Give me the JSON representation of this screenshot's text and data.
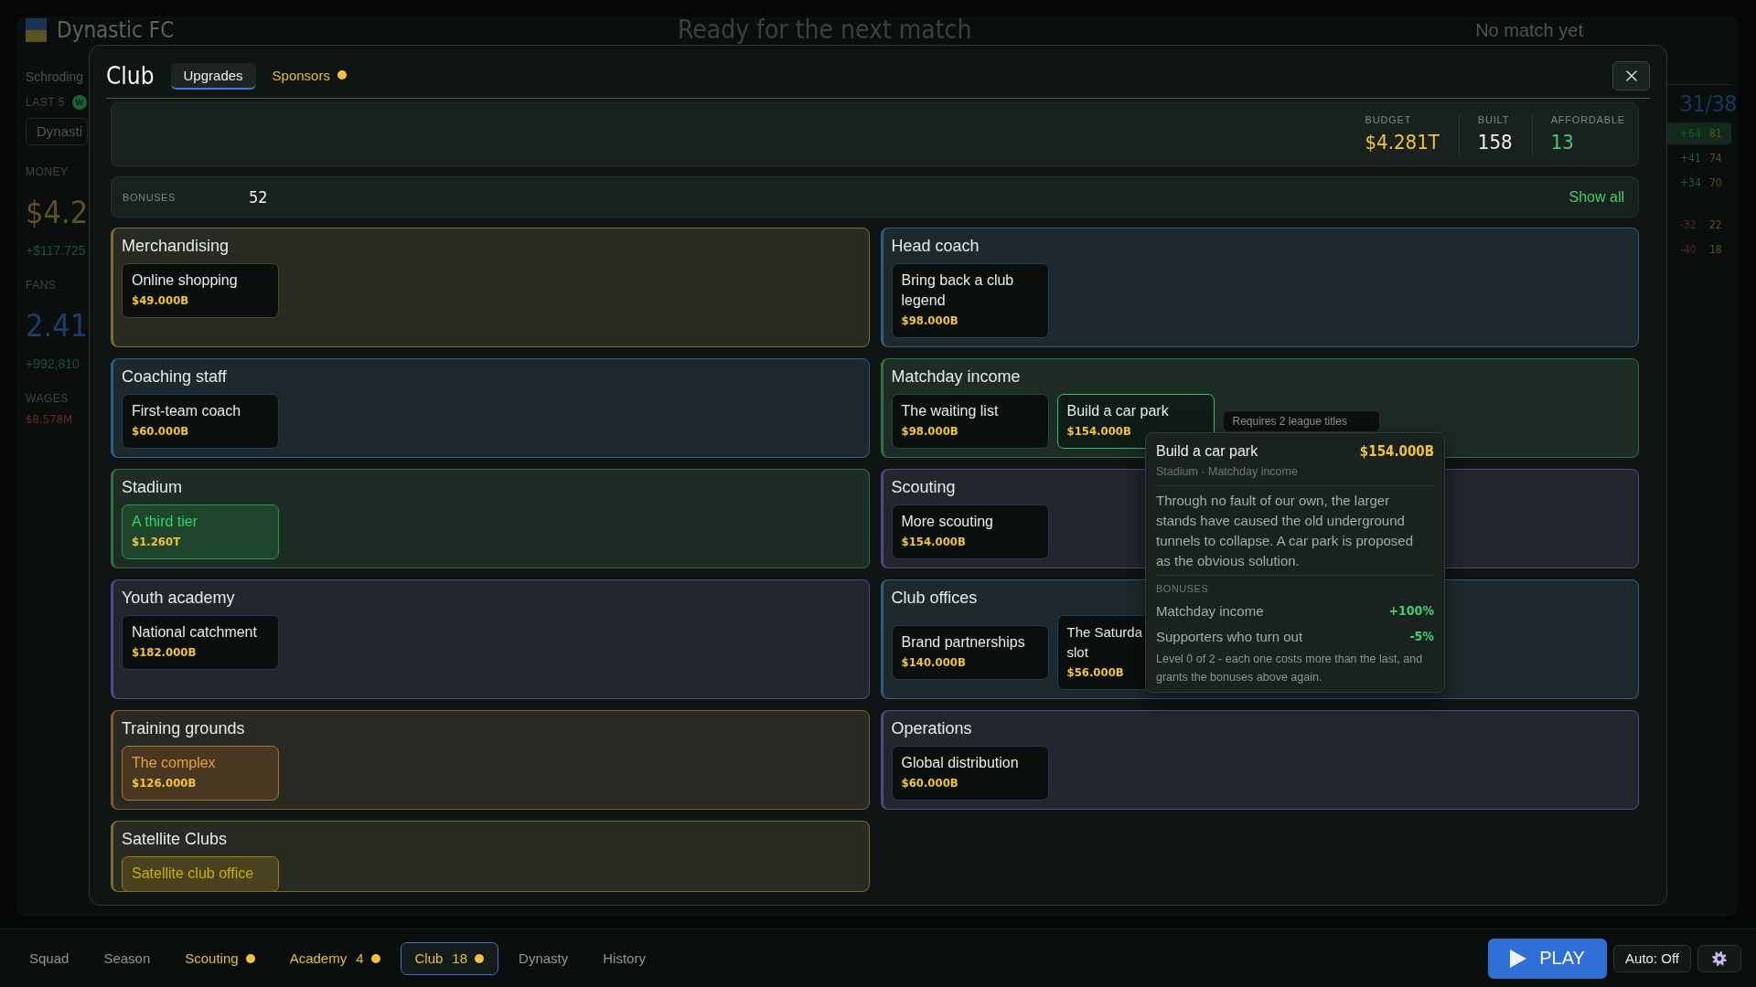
{
  "background": {
    "club": "Dynastic FC",
    "manager": "Schroding",
    "form": {
      "label": "LAST 5",
      "results": [
        {
          "letter": "W",
          "color": "#1b5e37"
        }
      ]
    },
    "team_select": "Dynasti",
    "stats": [
      {
        "kind": "big",
        "label": "MONEY",
        "value": "$4.2",
        "change": "+$117.725",
        "color": "#5e5222"
      },
      {
        "kind": "big",
        "label": "FANS",
        "value": "2.41",
        "change": "+992,810",
        "color": "#1f3d6b"
      },
      {
        "kind": "small",
        "label": "WAGES",
        "value": "$8.578M",
        "color": "#6a2824"
      }
    ],
    "headline": "Ready for the next match",
    "next_match": "No match yet",
    "league": {
      "progress": "31/38",
      "groups": [
        {
          "rows": [
            {
              "difference": "+64",
              "points": "81",
              "kind": "up",
              "highlighted": true
            },
            {
              "difference": "+41",
              "points": "74",
              "kind": "up",
              "highlighted": false
            },
            {
              "difference": "+34",
              "points": "70",
              "kind": "up",
              "highlighted": false
            }
          ]
        },
        {
          "rows": [
            {
              "difference": "-32",
              "points": "22",
              "kind": "down",
              "highlighted": false
            },
            {
              "difference": "-40",
              "points": "18",
              "kind": "down",
              "highlighted": false
            }
          ]
        }
      ]
    }
  },
  "modal": {
    "title": "Club",
    "tabs": [
      {
        "label": "Upgrades",
        "selected": true,
        "alert": false
      },
      {
        "label": "Sponsors",
        "selected": false,
        "alert": true
      }
    ],
    "summary": [
      {
        "label": "BUDGET",
        "value": "$4.281T",
        "kind": "money"
      },
      {
        "label": "BUILT",
        "value": "158",
        "kind": "plain"
      },
      {
        "label": "AFFORDABLE",
        "value": "13",
        "kind": "good"
      }
    ],
    "bonuses": {
      "label": "BONUSES",
      "count": "52",
      "action": "Show all"
    },
    "categories": [
      {
        "title": "Merchandising",
        "color": "#7d6c2c",
        "items": [
          {
            "kind": "upgrade",
            "name": "Online shopping",
            "price": "$49.000B",
            "owned": false,
            "hovered": false,
            "clipped": false
          }
        ]
      },
      {
        "title": "Head coach",
        "color": "#2b5f86",
        "items": [
          {
            "kind": "upgrade",
            "name": "Bring back a club legend",
            "price": "$98.000B",
            "owned": false,
            "hovered": false,
            "clipped": false
          }
        ]
      },
      {
        "title": "Coaching staff",
        "color": "#2b5f86",
        "items": [
          {
            "kind": "upgrade",
            "name": "First-team coach",
            "price": "$60.000B",
            "owned": false,
            "hovered": false,
            "clipped": false
          }
        ]
      },
      {
        "title": "Matchday income",
        "color": "#2d7444",
        "items": [
          {
            "kind": "upgrade",
            "name": "The waiting list",
            "price": "$98.000B",
            "owned": false,
            "hovered": false,
            "clipped": false
          },
          {
            "kind": "upgrade",
            "name": "Build a car park",
            "price": "$154.000B",
            "owned": false,
            "hovered": true,
            "clipped": false
          },
          {
            "kind": "locked",
            "label": "Requires 2 league titles"
          }
        ]
      },
      {
        "title": "Stadium",
        "color": "#2d7444",
        "items": [
          {
            "kind": "upgrade",
            "name": "A third tier",
            "price": "$1.260T",
            "owned": true,
            "hovered": false,
            "clipped": false
          }
        ]
      },
      {
        "title": "Scouting",
        "color": "#54478a",
        "items": [
          {
            "kind": "upgrade",
            "name": "More scouting",
            "price": "$154.000B",
            "owned": false,
            "hovered": false,
            "clipped": false
          }
        ]
      },
      {
        "title": "Youth academy",
        "color": "#54478a",
        "items": [
          {
            "kind": "upgrade",
            "name": "National catchment",
            "price": "$182.000B",
            "owned": false,
            "hovered": false,
            "clipped": false
          }
        ]
      },
      {
        "title": "Club offices",
        "color": "#2b5f86",
        "items": [
          {
            "kind": "upgrade",
            "name": "Brand partnerships",
            "price": "$140.000B",
            "owned": false,
            "hovered": false,
            "clipped": false
          },
          {
            "kind": "upgrade",
            "name": "The Saturda slot",
            "price": "$56.000B",
            "owned": false,
            "hovered": false,
            "clipped": true
          }
        ]
      },
      {
        "title": "Training grounds",
        "color": "#7f5a2e",
        "items": [
          {
            "kind": "upgrade",
            "name": "The complex",
            "price": "$126.000B",
            "owned": true,
            "hovered": false,
            "clipped": false
          }
        ]
      },
      {
        "title": "Operations",
        "color": "#54478a",
        "items": [
          {
            "kind": "upgrade",
            "name": "Global distribution",
            "price": "$60.000B",
            "owned": false,
            "hovered": false,
            "clipped": false
          }
        ]
      },
      {
        "title": "Satellite Clubs",
        "color": "#7d6c2c",
        "items": [
          {
            "kind": "upgrade",
            "name": "Satellite club office",
            "owned": true,
            "hovered": false,
            "clipped": false
          }
        ]
      }
    ],
    "tooltip": {
      "title": "Build a car park",
      "price": "$154.000B",
      "path": "Stadium · Matchday income",
      "description": "Through no fault of our own, the larger stands have caused the old underground tunnels to collapse. A car park is proposed as the obvious solution.",
      "bonuses_label": "BONUSES",
      "bonuses": [
        {
          "name": "Matchday income",
          "value": "+100%"
        },
        {
          "name": "Supporters who turn out",
          "value": "-5%"
        }
      ],
      "note": "Level 0 of 2 - each one costs more than the last, and grants the bonuses above again."
    }
  },
  "nav": {
    "tabs": [
      {
        "label": "Squad",
        "selected": false,
        "alert": false
      },
      {
        "label": "Season",
        "selected": false,
        "alert": false
      },
      {
        "label": "Scouting",
        "selected": false,
        "alert": true
      },
      {
        "label": "Academy",
        "count": "4",
        "selected": false,
        "alert": true
      },
      {
        "label": "Club",
        "count": "18",
        "selected": true,
        "alert": true
      },
      {
        "label": "Dynasty",
        "selected": false,
        "alert": false
      },
      {
        "label": "History",
        "selected": false,
        "alert": false
      }
    ],
    "play": "PLAY",
    "auto": "Auto: Off"
  }
}
